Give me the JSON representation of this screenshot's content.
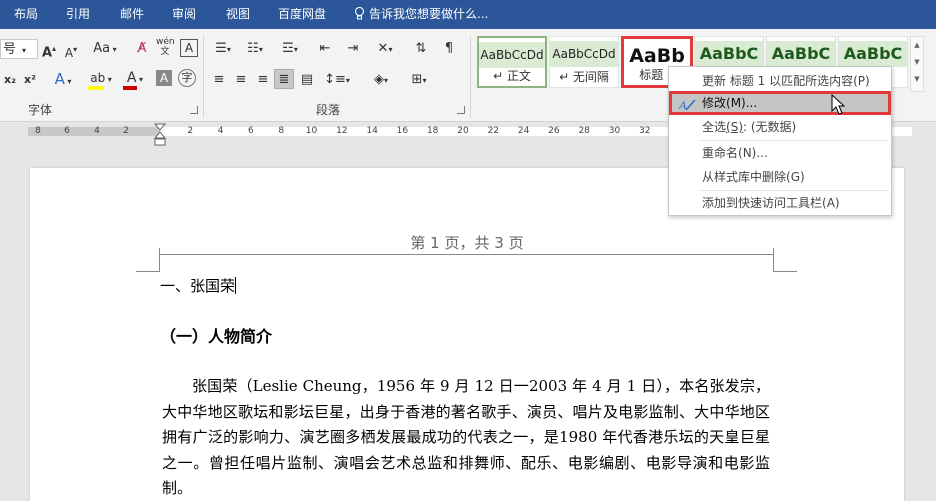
{
  "tabs": [
    "布局",
    "引用",
    "邮件",
    "审阅",
    "视图",
    "百度网盘"
  ],
  "tell_me": "告诉我您想要做什么...",
  "ribbon": {
    "font_size_suffix": "号",
    "change_case": "Aa",
    "groups": {
      "font": "字体",
      "paragraph": "段落"
    }
  },
  "styles": [
    {
      "preview": "AaBbCcDd",
      "name": "↵ 正文"
    },
    {
      "preview": "AaBbCcDd",
      "name": "↵ 无间隔"
    },
    {
      "preview": "AaBb",
      "name": "标题 1"
    },
    {
      "preview": "AaBbC",
      "name": ""
    },
    {
      "preview": "AaBbC",
      "name": ""
    },
    {
      "preview": "AaBbC",
      "name": ""
    }
  ],
  "ruler": {
    "left_numbers": [
      "8",
      "6",
      "4",
      "2"
    ],
    "right_numbers": [
      "2",
      "4",
      "6",
      "8",
      "10",
      "12",
      "14",
      "16",
      "18",
      "20",
      "22",
      "24",
      "26",
      "28",
      "30",
      "32",
      "34",
      "36",
      "38",
      "40",
      "42",
      "44",
      "46",
      "48"
    ]
  },
  "context_menu": {
    "items": [
      {
        "label": "更新 标题 1 以匹配所选内容",
        "key": "(P)"
      },
      {
        "label": "修改",
        "key": "(M)",
        "suffix": "..."
      },
      {
        "label": "全选",
        "key": "(S)",
        "suffix": ": (无数据)"
      },
      {
        "label": "重命名",
        "key": "(N)",
        "suffix": "..."
      },
      {
        "label": "从样式库中删除",
        "key": "(G)"
      },
      {
        "label": "添加到快速访问工具栏",
        "key": "(A)"
      }
    ]
  },
  "document": {
    "header": "第 1 页，共 3 页",
    "heading1": "一、张国荣",
    "heading2": "（一）人物简介",
    "paragraph": "张国荣（Leslie Cheung，1956 年 9 月 12 日一2003 年 4 月 1 日），本名张发宗，大中华地区歌坛和影坛巨星，出身于香港的著名歌手、演员、唱片及电影监制、大中华地区拥有广泛的影响力、演艺圈多栖发展最成功的代表之一，是1980 年代香港乐坛的天皇巨星之一。曾担任唱片监制、演唱会艺术总监和排舞师、配乐、电影编剧、电影导演和电影监制。"
  },
  "colors": {
    "title_bar": "#2b579a",
    "highlight_red": "#e03a3a",
    "font_color_red": "#d00000",
    "highlight_yellow": "#ffff00"
  }
}
